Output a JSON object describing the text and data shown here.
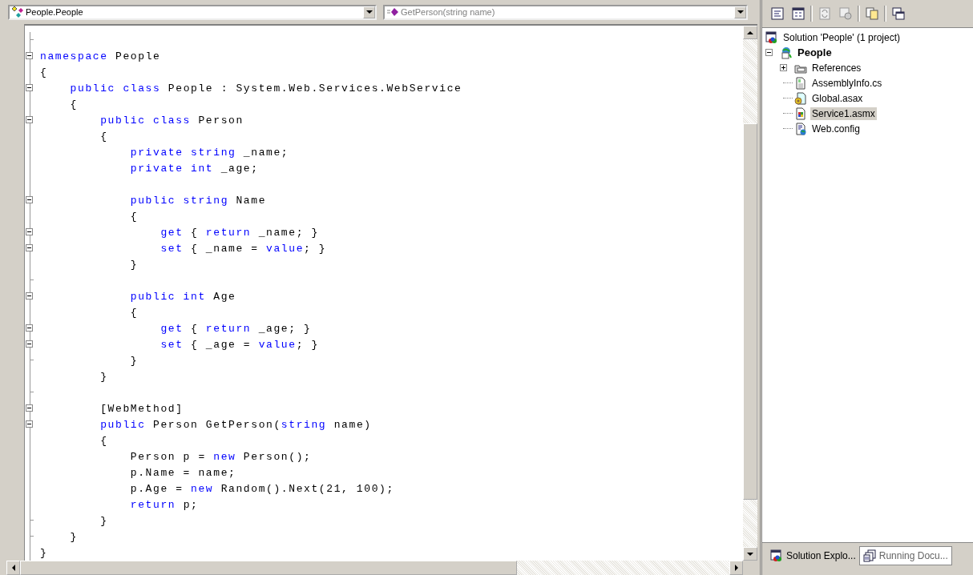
{
  "editor": {
    "type_dropdown": {
      "value": "People.People",
      "disabled": false
    },
    "member_dropdown": {
      "value": "GetPerson(string name)",
      "disabled": true
    },
    "lines": [
      {
        "kind": "block_end"
      },
      {
        "kind": "collapsible",
        "segments": [
          {
            "kind": "keyword",
            "text": "namespace"
          },
          {
            "kind": "plain",
            "text": " People"
          }
        ]
      },
      {
        "kind": "plain",
        "segments": [
          {
            "kind": "plain",
            "text": "{"
          }
        ]
      },
      {
        "kind": "collapsible",
        "segments": [
          {
            "kind": "keyword",
            "text": "    public class"
          },
          {
            "kind": "plain",
            "text": " People : System.Web.Services.WebService"
          }
        ]
      },
      {
        "kind": "plain",
        "segments": [
          {
            "kind": "plain",
            "text": "    {"
          }
        ]
      },
      {
        "kind": "collapsible",
        "segments": [
          {
            "kind": "keyword",
            "text": "        public class"
          },
          {
            "kind": "plain",
            "text": " Person"
          }
        ]
      },
      {
        "kind": "plain",
        "segments": [
          {
            "kind": "plain",
            "text": "        {"
          }
        ]
      },
      {
        "kind": "plain",
        "segments": [
          {
            "kind": "keyword",
            "text": "            private string"
          },
          {
            "kind": "plain",
            "text": " _name;"
          }
        ]
      },
      {
        "kind": "plain",
        "segments": [
          {
            "kind": "keyword",
            "text": "            private int"
          },
          {
            "kind": "plain",
            "text": " _age;"
          }
        ]
      },
      {
        "kind": "plain"
      },
      {
        "kind": "collapsible",
        "segments": [
          {
            "kind": "keyword",
            "text": "            public string"
          },
          {
            "kind": "plain",
            "text": " Name"
          }
        ]
      },
      {
        "kind": "plain",
        "segments": [
          {
            "kind": "plain",
            "text": "            {"
          }
        ]
      },
      {
        "kind": "collapsible",
        "segments": [
          {
            "kind": "keyword",
            "text": "                get"
          },
          {
            "kind": "plain",
            "text": " { "
          },
          {
            "kind": "keyword",
            "text": "return"
          },
          {
            "kind": "plain",
            "text": " _name; }"
          }
        ]
      },
      {
        "kind": "collapsible",
        "segments": [
          {
            "kind": "keyword",
            "text": "                set"
          },
          {
            "kind": "plain",
            "text": " { _name = "
          },
          {
            "kind": "keyword",
            "text": "value"
          },
          {
            "kind": "plain",
            "text": "; }"
          }
        ]
      },
      {
        "kind": "plain",
        "segments": [
          {
            "kind": "plain",
            "text": "            }"
          }
        ]
      },
      {
        "kind": "block_end"
      },
      {
        "kind": "collapsible",
        "segments": [
          {
            "kind": "keyword",
            "text": "            public int"
          },
          {
            "kind": "plain",
            "text": " Age"
          }
        ]
      },
      {
        "kind": "plain",
        "segments": [
          {
            "kind": "plain",
            "text": "            {"
          }
        ]
      },
      {
        "kind": "collapsible",
        "segments": [
          {
            "kind": "keyword",
            "text": "                get"
          },
          {
            "kind": "plain",
            "text": " { "
          },
          {
            "kind": "keyword",
            "text": "return"
          },
          {
            "kind": "plain",
            "text": " _age; }"
          }
        ]
      },
      {
        "kind": "collapsible",
        "segments": [
          {
            "kind": "keyword",
            "text": "                set"
          },
          {
            "kind": "plain",
            "text": " { _age = "
          },
          {
            "kind": "keyword",
            "text": "value"
          },
          {
            "kind": "plain",
            "text": "; }"
          }
        ]
      },
      {
        "kind": "block_end",
        "segments": [
          {
            "kind": "plain",
            "text": "            }"
          }
        ]
      },
      {
        "kind": "plain",
        "segments": [
          {
            "kind": "plain",
            "text": "        }"
          }
        ]
      },
      {
        "kind": "block_end"
      },
      {
        "kind": "collapsible",
        "segments": [
          {
            "kind": "plain",
            "text": "        [WebMethod]"
          }
        ]
      },
      {
        "kind": "collapsible",
        "segments": [
          {
            "kind": "keyword",
            "text": "        public"
          },
          {
            "kind": "plain",
            "text": " Person GetPerson("
          },
          {
            "kind": "keyword",
            "text": "string"
          },
          {
            "kind": "plain",
            "text": " name)"
          }
        ]
      },
      {
        "kind": "plain",
        "segments": [
          {
            "kind": "plain",
            "text": "        {"
          }
        ]
      },
      {
        "kind": "plain",
        "segments": [
          {
            "kind": "plain",
            "text": "            Person p = "
          },
          {
            "kind": "keyword",
            "text": "new"
          },
          {
            "kind": "plain",
            "text": " Person();"
          }
        ]
      },
      {
        "kind": "plain",
        "segments": [
          {
            "kind": "plain",
            "text": "            p.Name = name;"
          }
        ]
      },
      {
        "kind": "plain",
        "segments": [
          {
            "kind": "plain",
            "text": "            p.Age = "
          },
          {
            "kind": "keyword",
            "text": "new"
          },
          {
            "kind": "plain",
            "text": " Random().Next(21, 100);"
          }
        ]
      },
      {
        "kind": "plain",
        "segments": [
          {
            "kind": "keyword",
            "text": "            return"
          },
          {
            "kind": "plain",
            "text": " p;"
          }
        ]
      },
      {
        "kind": "block_end",
        "segments": [
          {
            "kind": "plain",
            "text": "        }"
          }
        ]
      },
      {
        "kind": "block_end",
        "segments": [
          {
            "kind": "plain",
            "text": "    }"
          }
        ]
      },
      {
        "kind": "plain",
        "segments": [
          {
            "kind": "plain",
            "text": "}"
          }
        ]
      }
    ]
  },
  "solution_explorer": {
    "tree": [
      {
        "kind": "solution",
        "label": "Solution 'People' (1 project)",
        "selected": false,
        "children": [
          {
            "kind": "project",
            "label": "People",
            "selected": false,
            "expanded": true,
            "children": [
              {
                "kind": "references",
                "label": "References",
                "selected": false,
                "expanded": false
              },
              {
                "kind": "csfile",
                "label": "AssemblyInfo.cs",
                "selected": false
              },
              {
                "kind": "global",
                "label": "Global.asax",
                "selected": false
              },
              {
                "kind": "service",
                "label": "Service1.asmx",
                "selected": true
              },
              {
                "kind": "config",
                "label": "Web.config",
                "selected": false
              }
            ]
          }
        ]
      }
    ],
    "tabs": [
      {
        "kind": "solution",
        "label": "Solution Explo...",
        "selected": true
      },
      {
        "kind": "documents",
        "label": "Running Docu...",
        "selected": false
      }
    ]
  }
}
